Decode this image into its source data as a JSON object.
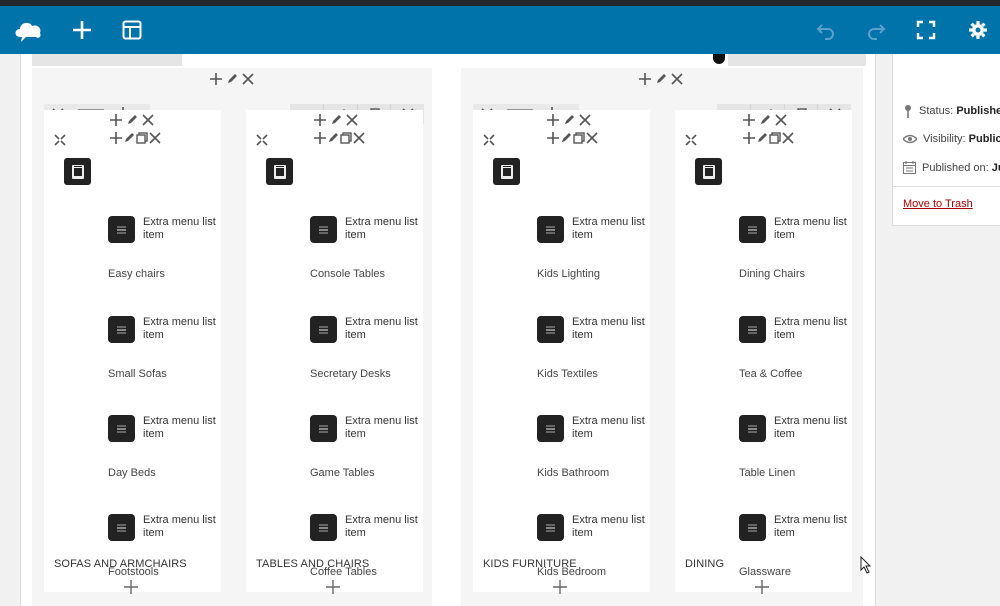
{
  "toolbar": {
    "logo_icon": "cloud-logo-icon",
    "add_icon": "plus-icon",
    "layout_icon": "layout-icon",
    "undo_icon": "undo-icon",
    "redo_icon": "redo-icon",
    "fullscreen_icon": "fullscreen-icon",
    "settings_icon": "gear-icon",
    "bg_color": "#0073aa"
  },
  "sidebar": {
    "status_label": "Status:",
    "status_value": "Publishe",
    "visibility_label": "Visibility:",
    "visibility_value": "Public",
    "published_label": "Published on:",
    "published_value": "Ju",
    "trash_link": "Move to Trash"
  },
  "columns": [
    {
      "title": "SOFAS AND ARMCHAIRS",
      "items": [
        {
          "text": "Extra menu list item",
          "name": "Easy chairs"
        },
        {
          "text": "Extra menu list item",
          "name": "Small Sofas"
        },
        {
          "text": "Extra menu list item",
          "name": "Day Beds"
        },
        {
          "text": "Extra menu list item",
          "name": "Footstools"
        }
      ]
    },
    {
      "title": "TABLES AND CHAIRS",
      "items": [
        {
          "text": "Extra menu list item",
          "name": "Console Tables"
        },
        {
          "text": "Extra menu list item",
          "name": "Secretary Desks"
        },
        {
          "text": "Extra menu list item",
          "name": "Game Tables"
        },
        {
          "text": "Extra menu list item",
          "name": "Coffee Tables"
        }
      ]
    },
    {
      "title": "KIDS FURNITURE",
      "items": [
        {
          "text": "Extra menu list item",
          "name": "Kids Lighting"
        },
        {
          "text": "Extra menu list item",
          "name": "Kids Textiles"
        },
        {
          "text": "Extra menu list item",
          "name": "Kids Bathroom"
        },
        {
          "text": "Extra menu list item",
          "name": "Kids Bedroom"
        }
      ]
    },
    {
      "title": "DINING",
      "items": [
        {
          "text": "Extra menu list item",
          "name": "Dining Chairs"
        },
        {
          "text": "Extra menu list item",
          "name": "Tea & Coffee"
        },
        {
          "text": "Extra menu list item",
          "name": "Table Linen"
        },
        {
          "text": "Extra menu list item",
          "name": "Glassware"
        }
      ]
    }
  ]
}
